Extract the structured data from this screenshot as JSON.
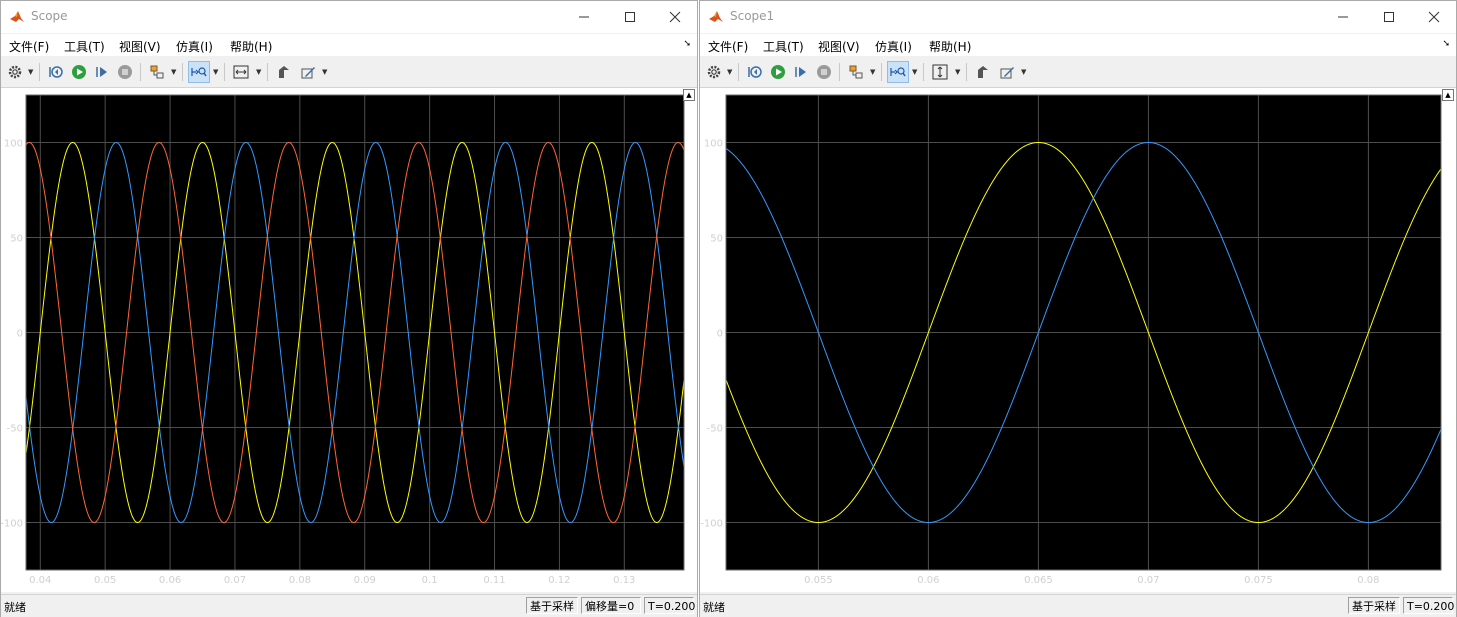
{
  "windows": [
    {
      "title": "Scope",
      "menu": [
        "文件(F)",
        "工具(T)",
        "视图(V)",
        "仿真(I)",
        "帮助(H)"
      ],
      "status": {
        "state": "就绪",
        "cells": [
          "基于采样",
          "偏移量=0",
          "T=0.200"
        ]
      }
    },
    {
      "title": "Scope1",
      "menu": [
        "文件(F)",
        "工具(T)",
        "视图(V)",
        "仿真(I)",
        "帮助(H)"
      ],
      "status": {
        "state": "就绪",
        "cells": [
          "基于采样",
          "T=0.200"
        ]
      }
    }
  ],
  "icons": {
    "app": "matlab-logo-icon",
    "minimize": "minimize-icon",
    "maximize": "maximize-icon",
    "close": "close-icon",
    "toolbar": [
      "settings-gear-icon",
      "step-back-icon",
      "run-icon",
      "step-forward-icon",
      "stop-icon",
      "highlight-block-icon",
      "zoom-icon",
      "autoscale-icon",
      "style-icon",
      "data-cursor-icon"
    ]
  },
  "colors": {
    "plot_bg": "#000000",
    "grid": "#4d4d4d",
    "tick_text": "#d0d0d0",
    "yellow": "#ffff00",
    "blue": "#3399ff",
    "orange": "#ff6633"
  },
  "chart_data": [
    {
      "type": "line",
      "xlim": [
        0.0378,
        0.1392
      ],
      "ylim": [
        -125,
        125
      ],
      "xticks": [
        0.04,
        0.05,
        0.06,
        0.07,
        0.08,
        0.09,
        0.1,
        0.11,
        0.12,
        0.13
      ],
      "yticks": [
        -100,
        -50,
        0,
        50,
        100
      ],
      "grid": true,
      "series": [
        {
          "color": "#ffff00",
          "amplitude": 100,
          "frequency_hz": 50,
          "x_at_peak": 0.045
        },
        {
          "color": "#3399ff",
          "amplitude": 100,
          "frequency_hz": 50,
          "x_at_peak": 0.0517
        },
        {
          "color": "#ff6633",
          "amplitude": 100,
          "frequency_hz": 50,
          "x_at_peak": 0.0383
        }
      ]
    },
    {
      "type": "line",
      "xlim": [
        0.0508,
        0.0833
      ],
      "ylim": [
        -125,
        125
      ],
      "xticks": [
        0.055,
        0.06,
        0.065,
        0.07,
        0.075,
        0.08
      ],
      "yticks": [
        -100,
        -50,
        0,
        50,
        100
      ],
      "grid": true,
      "series": [
        {
          "color": "#ffff00",
          "amplitude": 100,
          "frequency_hz": 50,
          "x_at_peak": 0.065
        },
        {
          "color": "#3399ff",
          "amplitude": 100,
          "frequency_hz": 50,
          "x_at_peak": 0.07
        }
      ]
    }
  ]
}
